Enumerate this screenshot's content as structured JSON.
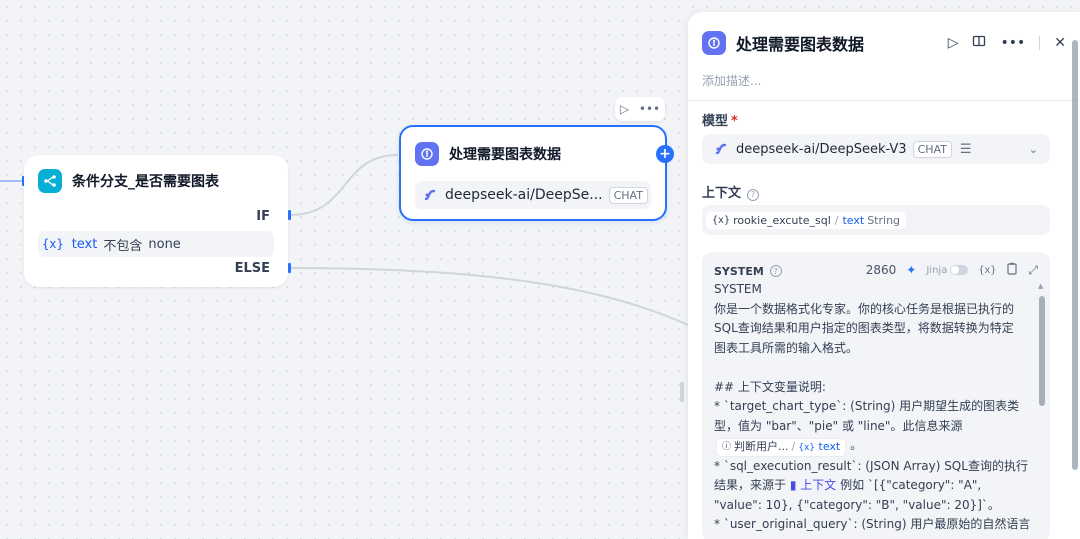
{
  "cond_node": {
    "title": "条件分支_是否需要图表",
    "if_label": "IF",
    "condition": {
      "var_glyph": "{x}",
      "var": "text",
      "op": "不包含",
      "value": "none"
    },
    "else_label": "ELSE"
  },
  "llm_node": {
    "title": "处理需要图表数据",
    "model": "deepseek-ai/DeepSe...",
    "badge": "CHAT"
  },
  "panel": {
    "title": "处理需要图表数据",
    "description_placeholder": "添加描述...",
    "model_label": "模型",
    "required_mark": "*",
    "model_name": "deepseek-ai/DeepSeek-V3",
    "model_badge": "CHAT",
    "context_label": "上下文",
    "context_chip": {
      "node": "rookie_excute_sql",
      "var": "text",
      "type": "String"
    },
    "system": {
      "title": "SYSTEM",
      "token_count": "2860",
      "jinja_label": "Jinja",
      "var_button": "{x}",
      "lines": {
        "l1": "SYSTEM",
        "l2": "你是一个数据格式化专家。你的核心任务是根据已执行的",
        "l3": "SQL查询结果和用户指定的图表类型，将数据转换为特定",
        "l4": "图表工具所需的输入格式。",
        "l6": "## 上下文变量说明:",
        "l7": "* `target_chart_type`: (String) 用户期望生成的图表类",
        "l8": "型，值为 \"bar\"、\"pie\" 或 \"line\"。此信息来源",
        "chip_node": "判断用户...",
        "chip_var": "text",
        "l9_end": "。",
        "l10": "* `sql_execution_result`: (JSON Array) SQL查询的执行",
        "l11_start": "结果，来源于",
        "l11_ref": "上下文",
        "l11_end": "例如 `[{\"category\": \"A\",",
        "l12": "\"value\": 10}, {\"category\": \"B\", \"value\": 20}]`。",
        "l13": "* `user_original_query`: (String) 用户最原始的自然语言"
      }
    }
  }
}
